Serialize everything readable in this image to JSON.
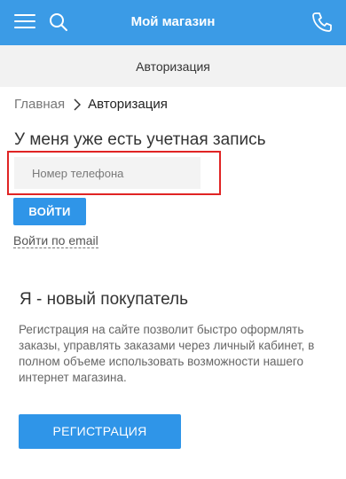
{
  "header": {
    "title": "Мой магазин",
    "menu_icon": "hamburger-menu-icon",
    "search_icon": "search-icon",
    "phone_icon": "phone-icon",
    "bg_color": "#3b9be6"
  },
  "subheader": {
    "label": "Авторизация"
  },
  "breadcrumb": {
    "home": "Главная",
    "current": "Авторизация"
  },
  "login": {
    "title": "У меня уже есть учетная запись",
    "phone_placeholder": "Номер телефона",
    "submit_label": "ВОЙТИ",
    "email_link": "Войти по email",
    "highlight_color": "#e02424"
  },
  "register": {
    "title": "Я - новый покупатель",
    "description": "Регистрация на сайте позволит быстро оформлять заказы, управлять заказами через личный кабинет, в полном объеме использовать возможности нашего интернет магазина.",
    "button_label": "РЕГИСТРАЦИЯ",
    "button_color": "#2f95e8"
  }
}
